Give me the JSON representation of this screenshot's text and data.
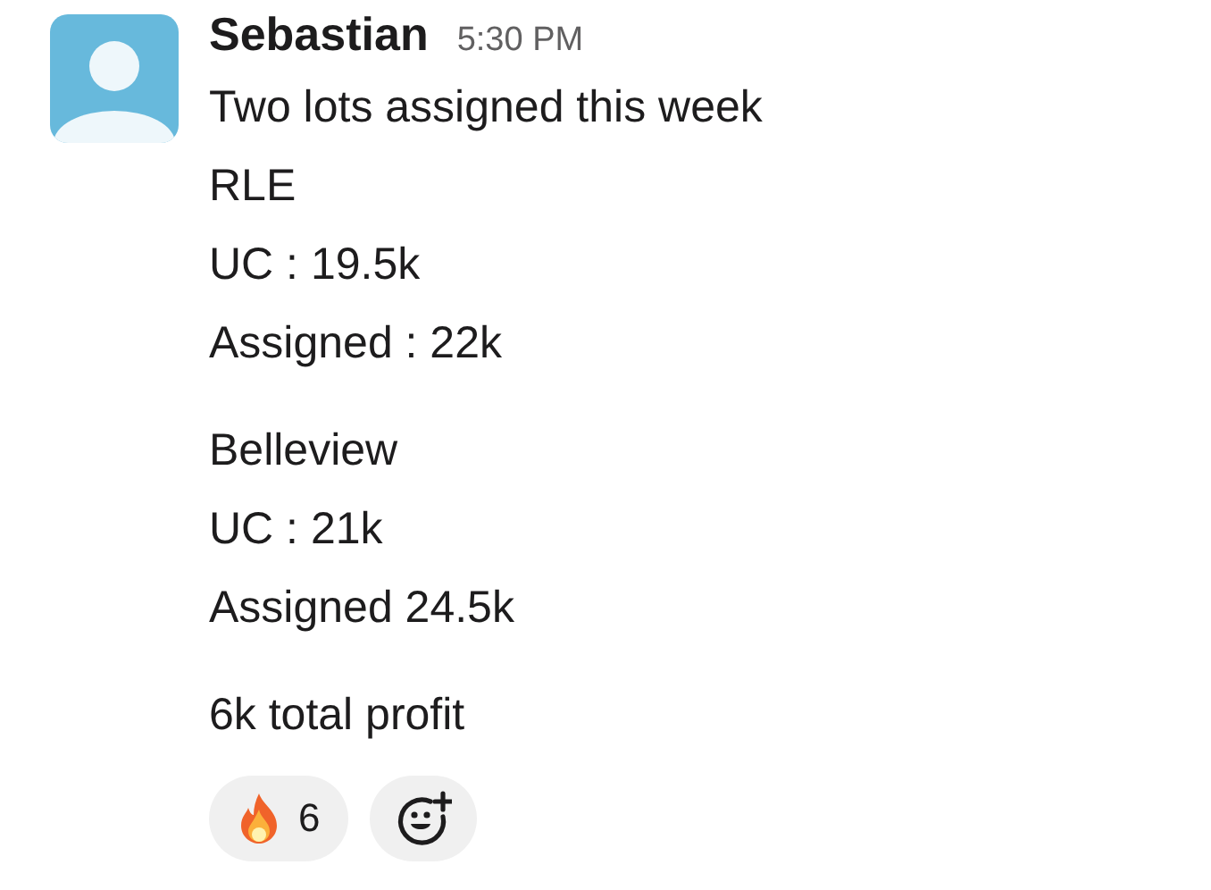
{
  "message": {
    "author": "Sebastian",
    "time": "5:30 PM",
    "paragraphs": [
      [
        "Two lots assigned this week",
        "RLE",
        "UC : 19.5k",
        "Assigned : 22k"
      ],
      [
        "Belleview",
        "UC : 21k",
        "Assigned 24.5k"
      ],
      [
        "6k total profit"
      ]
    ],
    "reactions": [
      {
        "kind": "fire",
        "count": "6"
      }
    ]
  }
}
